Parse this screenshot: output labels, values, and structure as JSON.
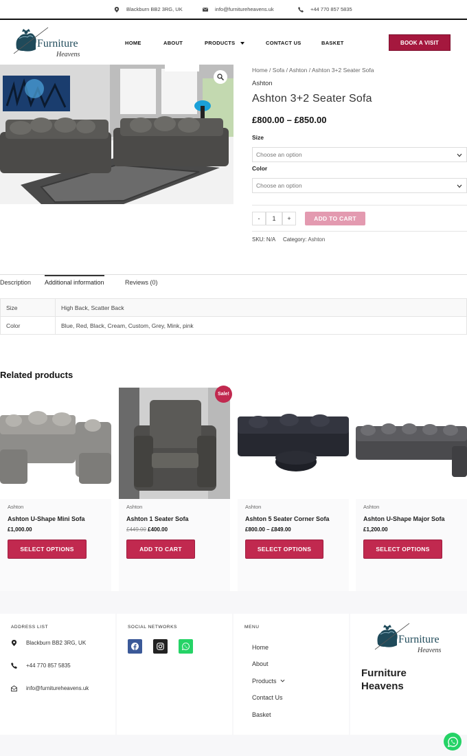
{
  "topbar": {
    "address": "Blackburn BB2 3RG, UK",
    "email": "info@furnitureheavens.uk",
    "phone": "+44 770 857 5835"
  },
  "header": {
    "logo_text": "Furniture",
    "logo_subtext": "Heavens",
    "nav": [
      "HOME",
      "ABOUT",
      "PRODUCTS",
      "CONTACT US",
      "BASKET"
    ],
    "book_button": "BOOK A VISIT"
  },
  "product": {
    "breadcrumb": [
      "Home",
      "Sofa",
      "Ashton",
      "Ashton 3+2 Seater Sofa"
    ],
    "category_label": "Ashton",
    "title": "Ashton 3+2 Seater Sofa",
    "price": "£800.00 – £850.00",
    "size_label": "Size",
    "size_placeholder": "Choose an option",
    "color_label": "Color",
    "color_placeholder": "Choose an option",
    "qty_minus": "-",
    "qty_value": "1",
    "qty_plus": "+",
    "add_to_cart": "ADD TO CART",
    "sku_label": "SKU:",
    "sku_value": "N/A",
    "category_meta_label": "Category:",
    "category_meta_value": "Ashton"
  },
  "tabs": [
    "Description",
    "Additional information",
    "Reviews (0)"
  ],
  "active_tab": "Additional information",
  "attributes": [
    {
      "name": "Size",
      "value": "High Back, Scatter Back"
    },
    {
      "name": "Color",
      "value": "Blue, Red, Black, Cream, Custom, Grey, Mink, pink"
    }
  ],
  "related": {
    "title": "Related products",
    "items": [
      {
        "category": "Ashton",
        "name": "Ashton U-Shape Mini Sofa",
        "old_price": "",
        "price": "£1,000.00",
        "button": "SELECT OPTIONS"
      },
      {
        "category": "Ashton",
        "name": "Ashton 1 Seater Sofa",
        "old_price": "£449.00",
        "price": "£400.00",
        "button": "ADD TO CART",
        "badge": "Sale!"
      },
      {
        "category": "Ashton",
        "name": "Ashton 5 Seater Corner Sofa",
        "old_price": "",
        "price": "£800.00 – £849.00",
        "button": "SELECT OPTIONS"
      },
      {
        "category": "Ashton",
        "name": "Ashton U-Shape Major Sofa",
        "old_price": "",
        "price": "£1,200.00",
        "button": "SELECT OPTIONS"
      }
    ]
  },
  "footer": {
    "address_heading": "ADDRESS LIST",
    "address": "Blackburn BB2 3RG, UK",
    "phone": "+44 770 857 5835",
    "email": "info@furnitureheavens.uk",
    "social_heading": "SOCIAL NETWORKS",
    "menu_heading": "MENU",
    "menu": [
      "Home",
      "About",
      "Products",
      "Contact Us",
      "Basket"
    ],
    "brand_name": "Furniture Heavens"
  },
  "colors": {
    "brand": "#a5183e",
    "button": "#c1294f",
    "add_to_cart_disabled": "#e39ab0",
    "facebook": "#3b5998",
    "instagram": "#222222",
    "whatsapp": "#25d366"
  }
}
